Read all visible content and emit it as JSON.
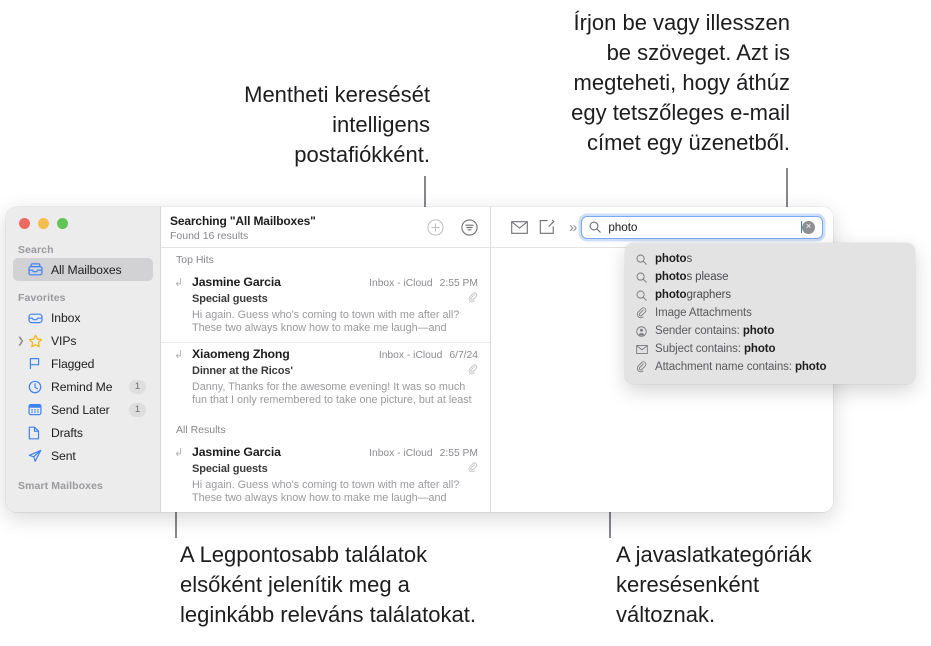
{
  "callouts": {
    "save_search": "Mentheti keresését\nintelligens\npostafiókként.",
    "type_or_paste": "Írjon be vagy illesszen\nbe szöveget. Azt is\nmegteheti, hogy áthúz\negy tetszőleges e-mail\ncímet egy üzenetből.",
    "top_hits": "A Legpontosabb találatok\nelsőként jelenítik meg a\nleginkább releváns találatokat.",
    "categories": "A javaslatkategóriák\nkeresésenként\nváltoznak."
  },
  "window": {
    "traffic_lights": [
      "close-red",
      "minimize-yellow",
      "zoom-green"
    ]
  },
  "sidebar": {
    "sections": {
      "search": "Search",
      "favorites": "Favorites",
      "smart_mailboxes": "Smart Mailboxes"
    },
    "search_items": [
      {
        "label": "All Mailboxes",
        "icon": "all-mailboxes-icon",
        "selected": true
      }
    ],
    "favorites": [
      {
        "label": "Inbox",
        "icon": "inbox-icon",
        "badge": "",
        "disclosure": false
      },
      {
        "label": "VIPs",
        "icon": "star-icon",
        "badge": "",
        "disclosure": true
      },
      {
        "label": "Flagged",
        "icon": "flag-icon",
        "badge": "",
        "disclosure": false
      },
      {
        "label": "Remind Me",
        "icon": "clock-icon",
        "badge": "1",
        "disclosure": false
      },
      {
        "label": "Send Later",
        "icon": "calendar-icon",
        "badge": "1",
        "disclosure": false
      },
      {
        "label": "Drafts",
        "icon": "document-icon",
        "badge": "",
        "disclosure": false
      },
      {
        "label": "Sent",
        "icon": "paper-plane-icon",
        "badge": "",
        "disclosure": false
      }
    ]
  },
  "list_header": {
    "title": "Searching \"All Mailboxes\"",
    "subtitle": "Found 16 results",
    "add_button": "add-smart-mailbox-icon",
    "filter_button": "filter-icon"
  },
  "groups": [
    {
      "heading": "Top Hits",
      "messages": [
        {
          "from": "Jasmine Garcia",
          "mailbox": "Inbox - iCloud",
          "time": "2:55 PM",
          "subject": "Special guests",
          "preview": "Hi again. Guess who's coming to town with me after all? These two always know how to make me laugh—and they're as insepa…",
          "attachment": true,
          "replied": true
        },
        {
          "from": "Xiaomeng Zhong",
          "mailbox": "Inbox - iCloud",
          "time": "6/7/24",
          "subject": "Dinner at the Ricos'",
          "preview": "Danny, Thanks for the awesome evening! It was so much fun that I only remembered to take one picture, but at least it's a good…",
          "attachment": true,
          "replied": true
        }
      ]
    },
    {
      "heading": "All Results",
      "messages": [
        {
          "from": "Jasmine Garcia",
          "mailbox": "Inbox - iCloud",
          "time": "2:55 PM",
          "subject": "Special guests",
          "preview": "Hi again. Guess who's coming to town with me after all? These two always know how to make me laugh—and they're as insepa…",
          "attachment": true,
          "replied": true
        }
      ]
    }
  ],
  "toolbar": {
    "mail_button": "envelope-icon",
    "compose_button": "compose-icon",
    "overflow_button": "»",
    "search": {
      "icon": "search-icon",
      "value": "photo",
      "placeholder": "Search",
      "clear": "×"
    }
  },
  "suggestions": [
    {
      "icon": "search-icon",
      "bold": "photo",
      "rest": "s",
      "prefix": ""
    },
    {
      "icon": "search-icon",
      "bold": "photo",
      "rest": "s please",
      "prefix": ""
    },
    {
      "icon": "search-icon",
      "bold": "photo",
      "rest": "graphers",
      "prefix": ""
    },
    {
      "icon": "paperclip-icon",
      "bold": "",
      "rest": "",
      "prefix": "Image Attachments"
    },
    {
      "icon": "person-icon",
      "bold": "photo",
      "rest": "",
      "prefix": "Sender contains: "
    },
    {
      "icon": "envelope-icon",
      "bold": "photo",
      "rest": "",
      "prefix": "Subject contains: "
    },
    {
      "icon": "paperclip-icon",
      "bold": "photo",
      "rest": "",
      "prefix": "Attachment name contains: "
    }
  ],
  "colors": {
    "accent_blue": "#3b7bf0",
    "icon_blue": "#3b82f6",
    "star_yellow": "#f5b50a",
    "traffic_red": "#ec6a5f",
    "traffic_yellow": "#f4bd4f",
    "traffic_green": "#61c454"
  }
}
